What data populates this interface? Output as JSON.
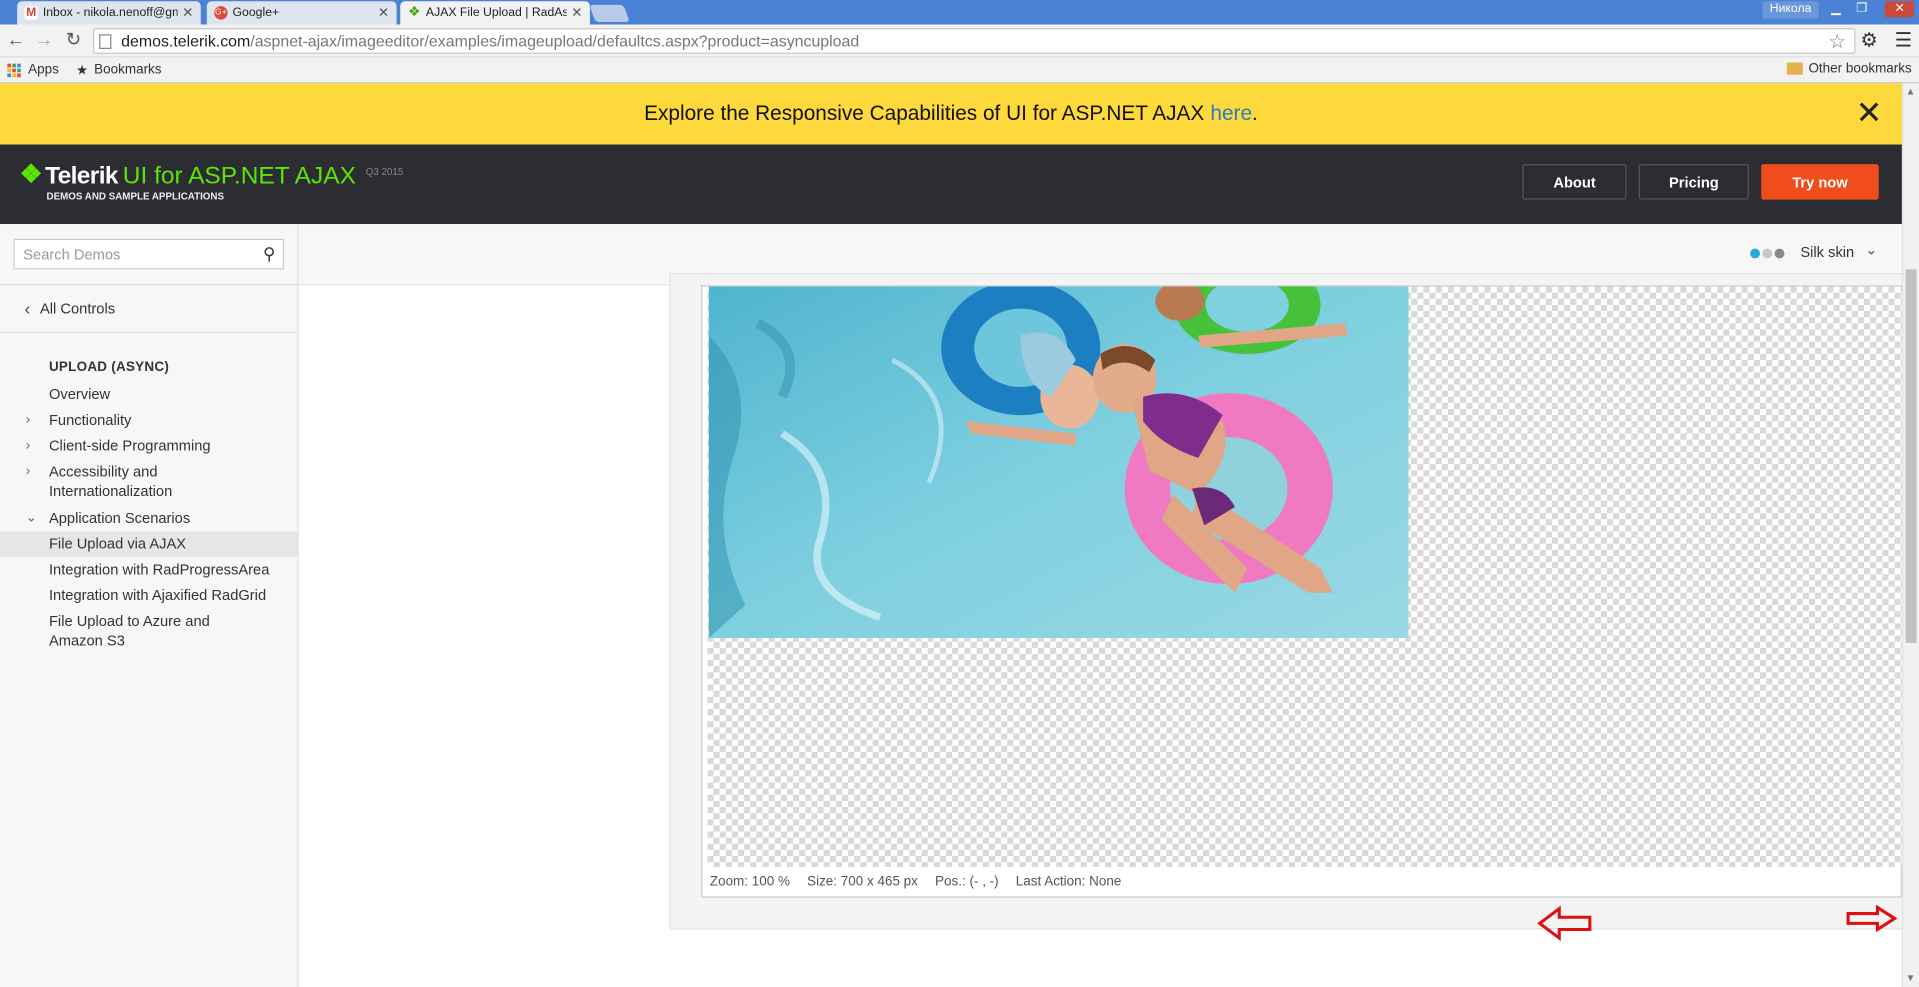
{
  "browser": {
    "tabs": [
      {
        "title": "Inbox - nikola.nenoff@gm",
        "favicon_color": "#d44638",
        "favicon": "gmail-icon"
      },
      {
        "title": "Google+",
        "favicon_color": "#dd4b39",
        "favicon": "google-plus-icon"
      },
      {
        "title": "AJAX File Upload | RadAsy",
        "favicon_color": "#5ce500",
        "favicon": "telerik-icon"
      }
    ],
    "user": "Никола",
    "url_host": "demos.telerik.com",
    "url_path": "/aspnet-ajax/imageeditor/examples/imageupload/defaultcs.aspx?product=asyncupload",
    "bookmarks": {
      "apps": "Apps",
      "bookmarks": "Bookmarks",
      "other": "Other bookmarks"
    }
  },
  "banner": {
    "text": "Explore the Responsive Capabilities of UI for ASP.NET AJAX",
    "link": "here",
    "end": ".",
    "color": "#fed93c"
  },
  "header": {
    "brand": "Telerik",
    "product": "UI for ASP.NET AJAX",
    "version": "Q3 2015",
    "subtitle": "DEMOS AND SAMPLE APPLICATIONS",
    "about": "About",
    "pricing": "Pricing",
    "try_now": "Try now",
    "accent": "#f14c1b",
    "brand_green": "#5ce500"
  },
  "sidebar": {
    "search_placeholder": "Search Demos",
    "all_controls": "All Controls",
    "section_title": "UPLOAD (ASYNC)",
    "items": [
      {
        "label": "Overview",
        "arrow": ""
      },
      {
        "label": "Functionality",
        "arrow": "collapsed"
      },
      {
        "label": "Client-side Programming",
        "arrow": "collapsed"
      },
      {
        "label": "Accessibility and Internationalization",
        "arrow": "collapsed"
      },
      {
        "label": "Application Scenarios",
        "arrow": "expanded"
      },
      {
        "label": "File Upload via AJAX",
        "arrow": "",
        "selected": true
      },
      {
        "label": "Integration with RadProgressArea",
        "arrow": ""
      },
      {
        "label": "Integration with Ajaxified RadGrid",
        "arrow": ""
      },
      {
        "label": "File Upload to Azure and Amazon S3",
        "arrow": ""
      }
    ]
  },
  "skin": {
    "label": "Silk skin",
    "dot_colors": [
      "#29a7d6",
      "#c8c8c8",
      "#888888"
    ]
  },
  "editor": {
    "status": {
      "zoom_label": "Zoom:",
      "zoom": "100 %",
      "size_label": "Size:",
      "size": "700 x 465 px",
      "pos_label": "Pos.:",
      "pos": "(- , -)",
      "action_label": "Last Action:",
      "action": "None"
    }
  }
}
